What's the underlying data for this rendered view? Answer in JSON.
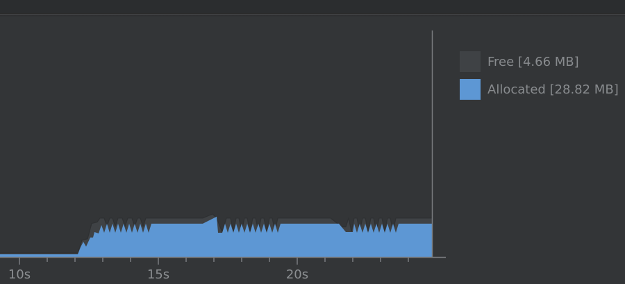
{
  "colors": {
    "background": "#333537",
    "free": "#3f4245",
    "allocated": "#5d97d4",
    "axis": "#7a7d80",
    "tick_text": "#8c8f92"
  },
  "legend": {
    "free": "Free [4.66 MB]",
    "allocated": "Allocated [28.82 MB]"
  },
  "chart_data": {
    "type": "area",
    "title": "",
    "xlabel": "",
    "ylabel": "",
    "x_unit": "s",
    "xlim": [
      9.3,
      24.85
    ],
    "ylim": [
      0,
      100
    ],
    "x_ticks": [
      {
        "value": 10,
        "label": "10s"
      },
      {
        "value": 15,
        "label": "15s"
      },
      {
        "value": 20,
        "label": "20s"
      }
    ],
    "grid": false,
    "legend_position": "right",
    "series": [
      {
        "name": "Free",
        "stacked_total": true,
        "points": [
          [
            9.3,
            1.8
          ],
          [
            12.1,
            1.8
          ],
          [
            12.25,
            7.4
          ],
          [
            12.45,
            8.0
          ],
          [
            12.6,
            14.8
          ],
          [
            12.8,
            15.4
          ],
          [
            12.9,
            17.2
          ],
          [
            13.05,
            17.2
          ],
          [
            13.15,
            13.5
          ],
          [
            13.25,
            17.2
          ],
          [
            13.35,
            17.2
          ],
          [
            13.45,
            13.5
          ],
          [
            13.55,
            17.2
          ],
          [
            13.7,
            17.2
          ],
          [
            13.8,
            13.5
          ],
          [
            13.9,
            17.2
          ],
          [
            14.05,
            17.2
          ],
          [
            14.15,
            13.5
          ],
          [
            14.25,
            17.2
          ],
          [
            14.35,
            17.2
          ],
          [
            14.45,
            13.5
          ],
          [
            14.55,
            17.2
          ],
          [
            16.6,
            17.2
          ],
          [
            16.95,
            19.0
          ],
          [
            17.1,
            17.2
          ],
          [
            17.3,
            11.0
          ],
          [
            17.45,
            17.2
          ],
          [
            17.6,
            17.2
          ],
          [
            17.7,
            11.3
          ],
          [
            17.8,
            17.2
          ],
          [
            17.9,
            17.2
          ],
          [
            18.0,
            11.3
          ],
          [
            18.1,
            17.2
          ],
          [
            18.2,
            17.2
          ],
          [
            18.3,
            11.3
          ],
          [
            18.4,
            17.2
          ],
          [
            18.5,
            17.2
          ],
          [
            18.6,
            11.3
          ],
          [
            18.7,
            17.2
          ],
          [
            18.8,
            17.2
          ],
          [
            18.9,
            11.3
          ],
          [
            19.0,
            17.2
          ],
          [
            19.1,
            17.2
          ],
          [
            19.2,
            11.3
          ],
          [
            19.3,
            17.2
          ],
          [
            21.2,
            17.2
          ],
          [
            21.6,
            13.3
          ],
          [
            21.75,
            13.3
          ],
          [
            21.85,
            17.2
          ],
          [
            21.95,
            11.3
          ],
          [
            22.05,
            17.2
          ],
          [
            22.15,
            17.2
          ],
          [
            22.25,
            11.3
          ],
          [
            22.35,
            17.2
          ],
          [
            22.45,
            17.2
          ],
          [
            22.55,
            11.3
          ],
          [
            22.65,
            17.2
          ],
          [
            22.75,
            17.2
          ],
          [
            22.85,
            11.3
          ],
          [
            22.95,
            17.2
          ],
          [
            23.05,
            17.2
          ],
          [
            23.15,
            11.3
          ],
          [
            23.25,
            17.2
          ],
          [
            23.35,
            17.2
          ],
          [
            23.45,
            11.3
          ],
          [
            23.55,
            17.2
          ],
          [
            24.85,
            17.2
          ]
        ]
      },
      {
        "name": "Allocated",
        "points": [
          [
            9.3,
            1.2
          ],
          [
            12.1,
            1.2
          ],
          [
            12.2,
            4.3
          ],
          [
            12.3,
            6.7
          ],
          [
            12.4,
            4.6
          ],
          [
            12.55,
            8.6
          ],
          [
            12.65,
            8.6
          ],
          [
            12.7,
            11.0
          ],
          [
            12.85,
            10.4
          ],
          [
            12.95,
            14.1
          ],
          [
            13.05,
            10.7
          ],
          [
            13.15,
            14.7
          ],
          [
            13.25,
            10.7
          ],
          [
            13.35,
            14.7
          ],
          [
            13.45,
            10.7
          ],
          [
            13.55,
            14.7
          ],
          [
            13.65,
            10.7
          ],
          [
            13.75,
            14.7
          ],
          [
            13.85,
            10.7
          ],
          [
            13.95,
            14.7
          ],
          [
            14.05,
            10.7
          ],
          [
            14.15,
            14.7
          ],
          [
            14.25,
            10.7
          ],
          [
            14.35,
            14.7
          ],
          [
            14.45,
            10.7
          ],
          [
            14.55,
            14.7
          ],
          [
            14.65,
            10.7
          ],
          [
            14.75,
            14.7
          ],
          [
            14.9,
            14.7
          ],
          [
            16.6,
            14.7
          ],
          [
            17.1,
            17.8
          ],
          [
            17.15,
            10.7
          ],
          [
            17.3,
            10.7
          ],
          [
            17.4,
            14.7
          ],
          [
            17.5,
            10.7
          ],
          [
            17.6,
            14.7
          ],
          [
            17.7,
            10.7
          ],
          [
            17.8,
            14.7
          ],
          [
            17.9,
            10.7
          ],
          [
            18.0,
            14.7
          ],
          [
            18.1,
            10.7
          ],
          [
            18.2,
            14.7
          ],
          [
            18.3,
            10.7
          ],
          [
            18.4,
            14.7
          ],
          [
            18.5,
            10.7
          ],
          [
            18.6,
            14.7
          ],
          [
            18.7,
            10.7
          ],
          [
            18.8,
            14.7
          ],
          [
            18.9,
            10.7
          ],
          [
            19.0,
            14.7
          ],
          [
            19.1,
            10.7
          ],
          [
            19.2,
            14.7
          ],
          [
            19.3,
            10.7
          ],
          [
            19.4,
            14.7
          ],
          [
            21.5,
            14.7
          ],
          [
            21.75,
            11.0
          ],
          [
            22.0,
            11.0
          ],
          [
            22.05,
            14.7
          ],
          [
            22.15,
            10.7
          ],
          [
            22.25,
            14.7
          ],
          [
            22.35,
            10.7
          ],
          [
            22.45,
            14.7
          ],
          [
            22.55,
            10.7
          ],
          [
            22.65,
            14.7
          ],
          [
            22.75,
            10.7
          ],
          [
            22.85,
            14.7
          ],
          [
            22.95,
            10.7
          ],
          [
            23.05,
            14.7
          ],
          [
            23.15,
            10.7
          ],
          [
            23.25,
            14.7
          ],
          [
            23.35,
            10.7
          ],
          [
            23.45,
            14.7
          ],
          [
            23.55,
            10.7
          ],
          [
            23.65,
            14.7
          ],
          [
            24.85,
            14.7
          ]
        ]
      }
    ]
  }
}
